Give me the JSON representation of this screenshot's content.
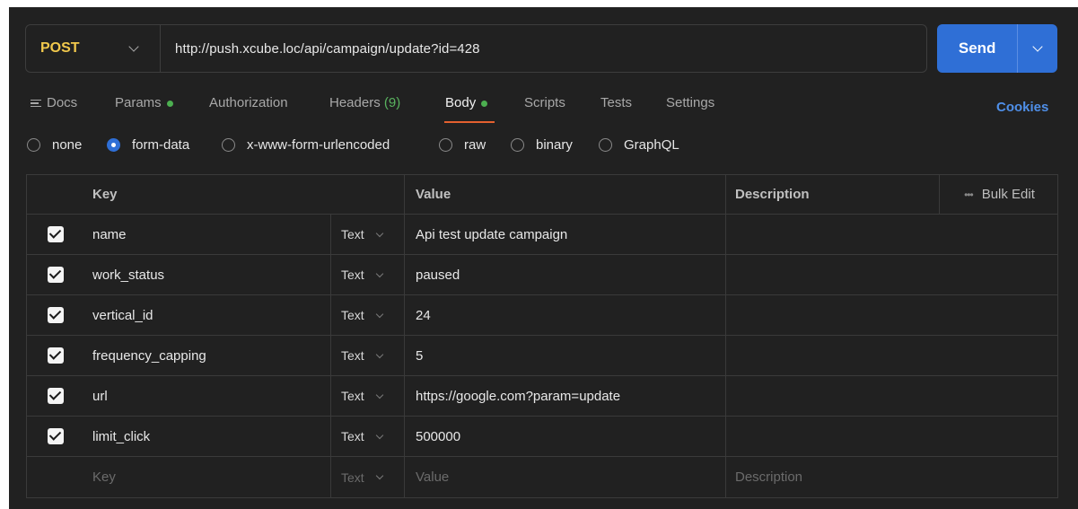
{
  "request": {
    "method": "POST",
    "url": "http://push.xcube.loc/api/campaign/update?id=428",
    "send_label": "Send"
  },
  "tabs": {
    "docs": "Docs",
    "params": "Params",
    "authorization": "Authorization",
    "headers": "Headers",
    "headers_count": "(9)",
    "body": "Body",
    "scripts": "Scripts",
    "tests": "Tests",
    "settings": "Settings",
    "cookies": "Cookies"
  },
  "body_types": {
    "none": "none",
    "form_data": "form-data",
    "urlencoded": "x-www-form-urlencoded",
    "raw": "raw",
    "binary": "binary",
    "graphql": "GraphQL",
    "selected": "form-data"
  },
  "table": {
    "headers": {
      "key": "Key",
      "value": "Value",
      "description": "Description",
      "bulk_edit": "Bulk Edit"
    },
    "rows": [
      {
        "key": "name",
        "type": "Text",
        "value": "Api test update campaign",
        "checked": true
      },
      {
        "key": "work_status",
        "type": "Text",
        "value": "paused",
        "checked": true
      },
      {
        "key": "vertical_id",
        "type": "Text",
        "value": "24",
        "checked": true
      },
      {
        "key": "frequency_capping",
        "type": "Text",
        "value": "5",
        "checked": true
      },
      {
        "key": "url",
        "type": "Text",
        "value": "https://google.com?param=update",
        "checked": true
      },
      {
        "key": "limit_click",
        "type": "Text",
        "value": "500000",
        "checked": true
      }
    ],
    "placeholder": {
      "key": "Key",
      "type": "Text",
      "value": "Value",
      "description": "Description"
    }
  },
  "colors": {
    "background": "#212121",
    "method": "#f1c84c",
    "send": "#2f6fd6",
    "active_underline": "#e4602f",
    "status_dot": "#4caf50",
    "link": "#4f8fe8"
  }
}
